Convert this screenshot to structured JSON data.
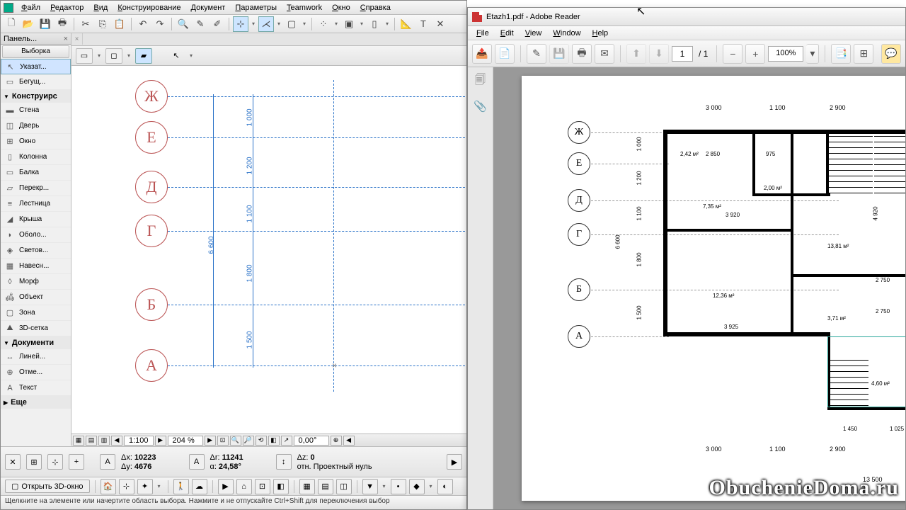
{
  "archicad": {
    "menu": [
      "Файл",
      "Редактор",
      "Вид",
      "Конструирование",
      "Документ",
      "Параметры",
      "Teamwork",
      "Окно",
      "Справка"
    ],
    "toolbox": {
      "title": "Панель...",
      "selector": "Выборка",
      "pointer": "Указат...",
      "marquee": "Бегущ...",
      "group1": "Конструирс",
      "tools": [
        "Стена",
        "Дверь",
        "Окно",
        "Колонна",
        "Балка",
        "Перекр...",
        "Лестница",
        "Крыша",
        "Оболо...",
        "Светов...",
        "Навесн...",
        "Морф",
        "Объект",
        "Зона",
        "3D-сетка"
      ],
      "group2": "Документи",
      "doctools": [
        "Линей...",
        "Отме...",
        "Текст"
      ],
      "more": "Еще"
    },
    "scale": {
      "ratio": "1:100",
      "zoom": "204 %",
      "angle": "0,00°"
    },
    "coords": {
      "dx": "Δx:",
      "dxv": "10223",
      "dy": "Δy:",
      "dyv": "4676",
      "dr": "Δr:",
      "drv": "11241",
      "da": "α:",
      "dav": "24,58°",
      "dz": "Δz:",
      "dzv": "0",
      "ref": "отн. Проектный нуль"
    },
    "open3d": "Открыть 3D-окно",
    "status": "Щелкните на элементе или начертите область выбора. Нажмите и не отпускайте Ctrl+Shift для переключения выбор",
    "bubbles": [
      "Ж",
      "Е",
      "Д",
      "Г",
      "Б",
      "А"
    ],
    "dims": [
      "1 000",
      "1 200",
      "1 100",
      "1 800",
      "1 500",
      "6 600"
    ]
  },
  "reader": {
    "title": "Etazh1.pdf - Adobe Reader",
    "menu": [
      "File",
      "Edit",
      "View",
      "Window",
      "Help"
    ],
    "page_cur": "1",
    "page_total": "/ 1",
    "zoom": "100%",
    "bubbles": [
      "Ж",
      "Е",
      "Д",
      "Г",
      "Б",
      "А"
    ],
    "topdims": [
      "3 000",
      "1 100",
      "2 900"
    ],
    "botdims": [
      "3 000",
      "1 100",
      "2 900"
    ],
    "vdims": [
      "1 000",
      "1 200",
      "1 100",
      "1 800",
      "1 500",
      "6 600"
    ],
    "areas": {
      "a1": "2,42 м²",
      "a2": "2 850",
      "a3": "975",
      "a4": "2,00 м²",
      "a5": "7,35 м²",
      "a6": "3 920",
      "a7": "13,81 м²",
      "a8": "12,36 м²",
      "a9": "3 925",
      "a10": "3,71 м²",
      "a11": "2 750",
      "a12": "2 750",
      "a13": "4,60 м²",
      "a14": "1 450",
      "a15": "1 025",
      "a16": "13 500",
      "a17": "4 920"
    }
  },
  "watermark": "ObuchenieDoma.ru"
}
